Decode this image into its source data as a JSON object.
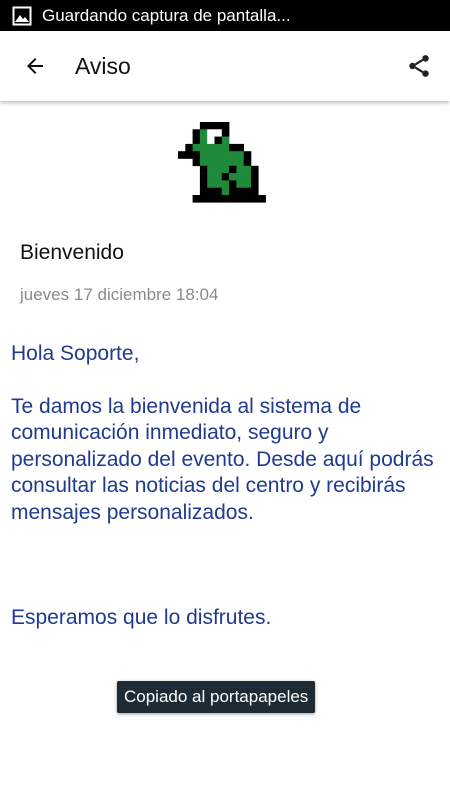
{
  "status_bar": {
    "notification_icon": "image-icon",
    "text": "Guardando captura de pantalla..."
  },
  "app_bar": {
    "back_icon": "arrow-left-icon",
    "title": "Aviso",
    "share_icon": "share-icon"
  },
  "logo": {
    "icon": "frog-pixel-logo",
    "color": "#1f8a3c"
  },
  "message": {
    "title": "Bienvenido",
    "date": "jueves 17 diciembre 18:04",
    "greeting": "Hola Soporte,",
    "body": "Te damos la bienvenida al sistema de comunicación inmediato, seguro y personalizado del evento. Desde aquí podrás consultar las noticias del centro y recibirás mensajes personalizados.",
    "closing": "Esperamos que lo disfrutes.",
    "text_color": "#1f3a8f"
  },
  "toast": {
    "text": "Copiado al portapapeles"
  }
}
